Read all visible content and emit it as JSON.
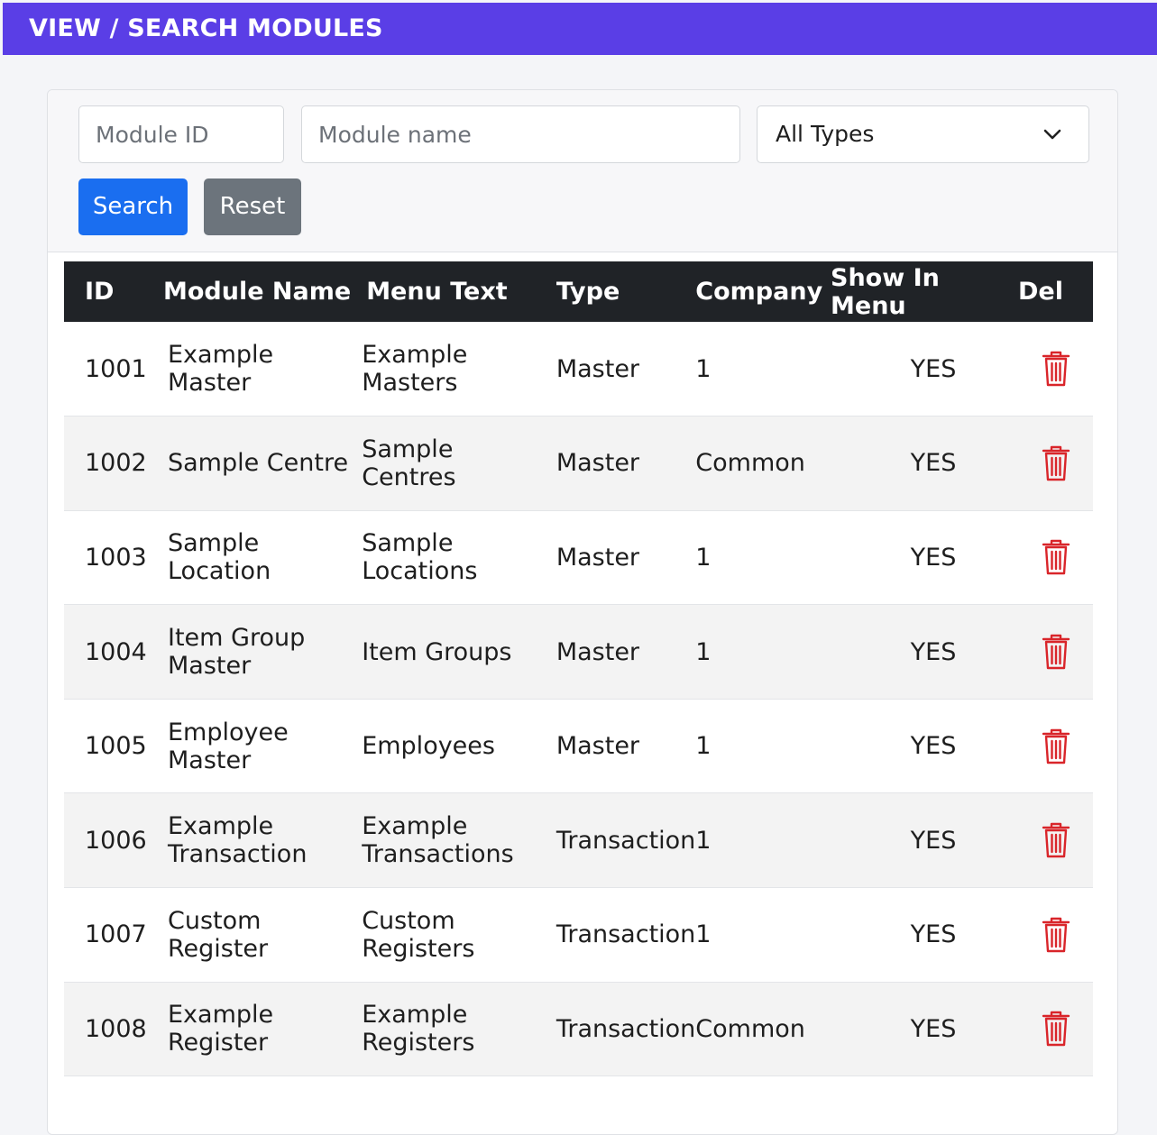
{
  "header": {
    "title": "VIEW / SEARCH MODULES"
  },
  "filters": {
    "module_id_placeholder": "Module ID",
    "module_name_placeholder": "Module name",
    "type_selected": "All Types",
    "search_label": "Search",
    "reset_label": "Reset"
  },
  "colors": {
    "header_bg": "#5a3ee6",
    "search_button": "#1a6ef0",
    "reset_button": "#6c747c",
    "table_header_bg": "#202327",
    "delete_icon": "#d9252a"
  },
  "table": {
    "columns": [
      "ID",
      "Module Name",
      "Menu Text",
      "Type",
      "Company",
      "Show In Menu",
      "Del"
    ],
    "rows": [
      {
        "id": "1001",
        "module_name": "Example Master",
        "menu_text": "Example Masters",
        "type": "Master",
        "company": "1",
        "show_in_menu": "YES"
      },
      {
        "id": "1002",
        "module_name": "Sample Centre",
        "menu_text": "Sample Centres",
        "type": "Master",
        "company": "Common",
        "show_in_menu": "YES"
      },
      {
        "id": "1003",
        "module_name": "Sample Location",
        "menu_text": "Sample Locations",
        "type": "Master",
        "company": "1",
        "show_in_menu": "YES"
      },
      {
        "id": "1004",
        "module_name": "Item Group Master",
        "menu_text": "Item Groups",
        "type": "Master",
        "company": "1",
        "show_in_menu": "YES"
      },
      {
        "id": "1005",
        "module_name": "Employee Master",
        "menu_text": "Employees",
        "type": "Master",
        "company": "1",
        "show_in_menu": "YES"
      },
      {
        "id": "1006",
        "module_name": "Example Transaction",
        "menu_text": "Example Transactions",
        "type": "Transaction",
        "company": "1",
        "show_in_menu": "YES"
      },
      {
        "id": "1007",
        "module_name": "Custom Register",
        "menu_text": "Custom Registers",
        "type": "Transaction",
        "company": "1",
        "show_in_menu": "YES"
      },
      {
        "id": "1008",
        "module_name": "Example Register",
        "menu_text": "Example Registers",
        "type": "Transaction",
        "company": "Common",
        "show_in_menu": "YES"
      }
    ]
  }
}
